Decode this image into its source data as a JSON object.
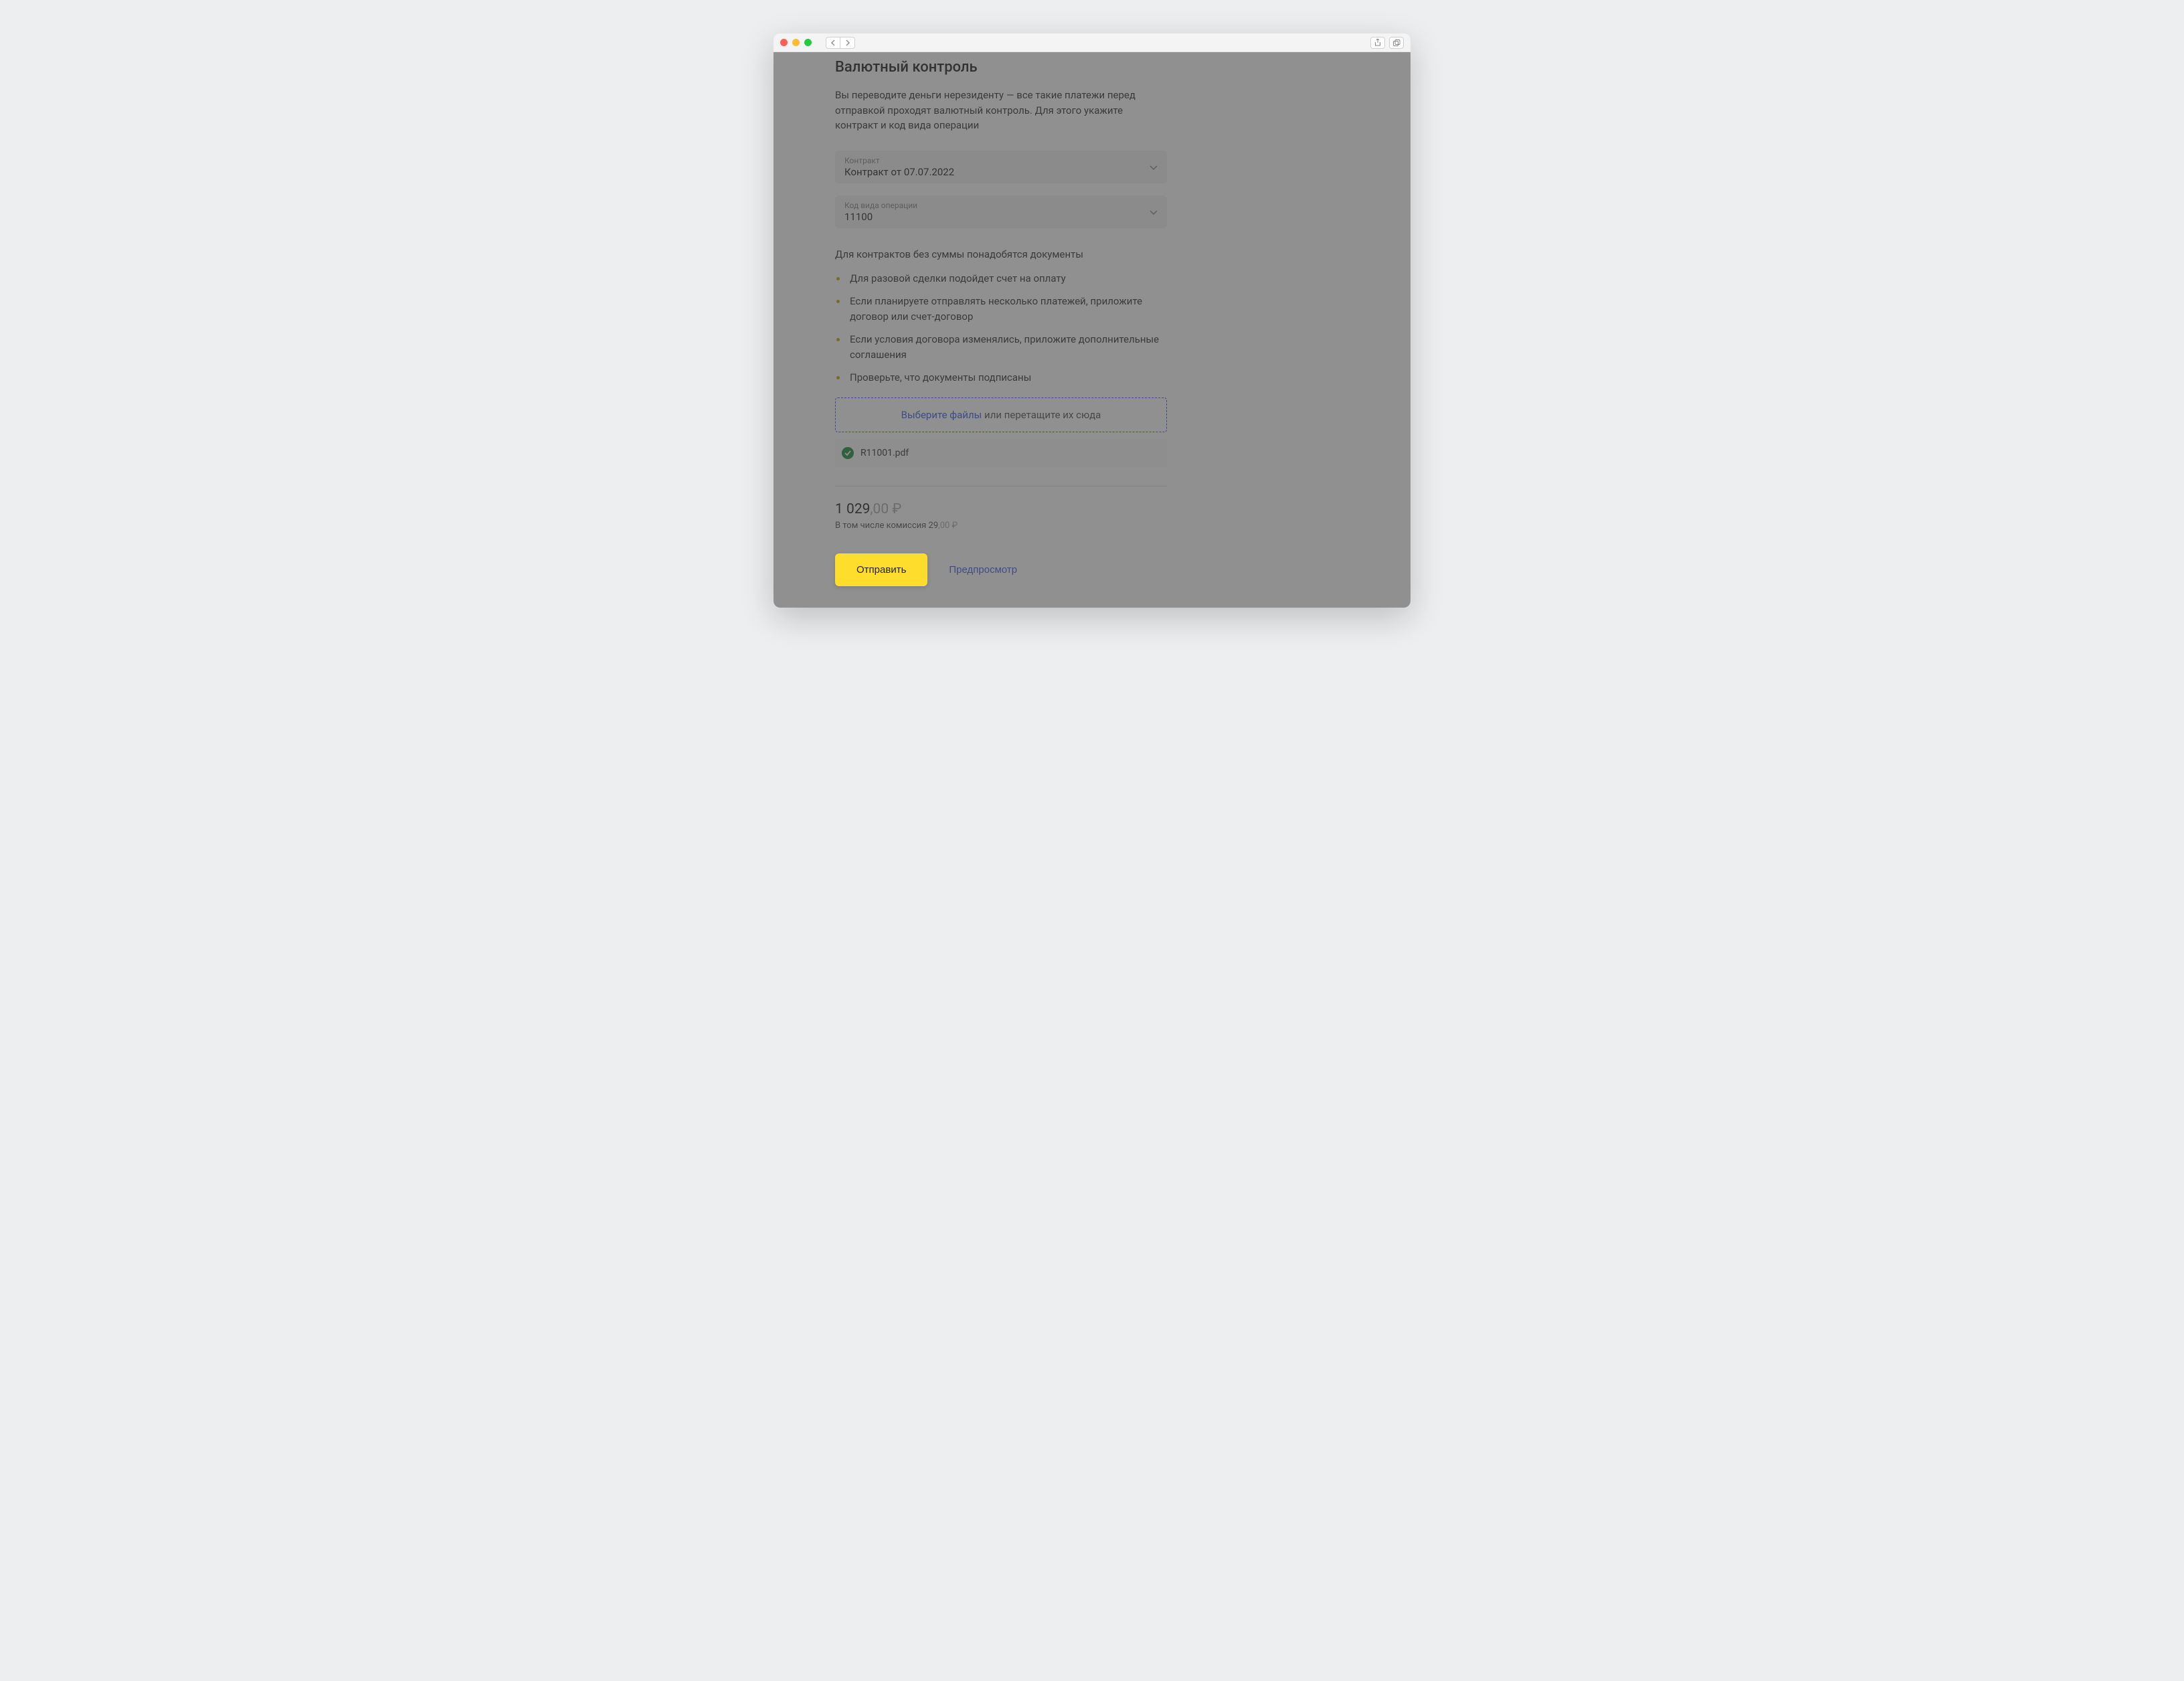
{
  "page": {
    "title": "Валютный контроль",
    "intro": "Вы переводите деньги нерезиденту — все такие платежи перед отправкой проходят валютный контроль. Для этого укажите контракт и код вида операции"
  },
  "fields": {
    "contract": {
      "label": "Контракт",
      "value": "Контракт от 07.07.2022"
    },
    "operation": {
      "label": "Код вида операции",
      "value": "11100"
    }
  },
  "docs": {
    "note": "Для контрактов без суммы понадобятся документы",
    "items": [
      "Для разовой сделки подойдет счет на оплату",
      "Если планируете отправлять несколько платежей, приложите договор или счет-договор",
      "Если условия договора изменялись, приложите дополнительные соглашения",
      "Проверьте, что документы подписаны"
    ]
  },
  "upload": {
    "choose": "Выберите файлы",
    "drag": " или перетащите их сюда",
    "file": "R11001.pdf"
  },
  "total": {
    "amount_int": "1 029",
    "amount_dec": ",00 ₽",
    "commission_prefix": "В том числе комиссия 29",
    "commission_dec": ",00 ₽"
  },
  "actions": {
    "submit": "Отправить",
    "preview": "Предпросмотр"
  }
}
